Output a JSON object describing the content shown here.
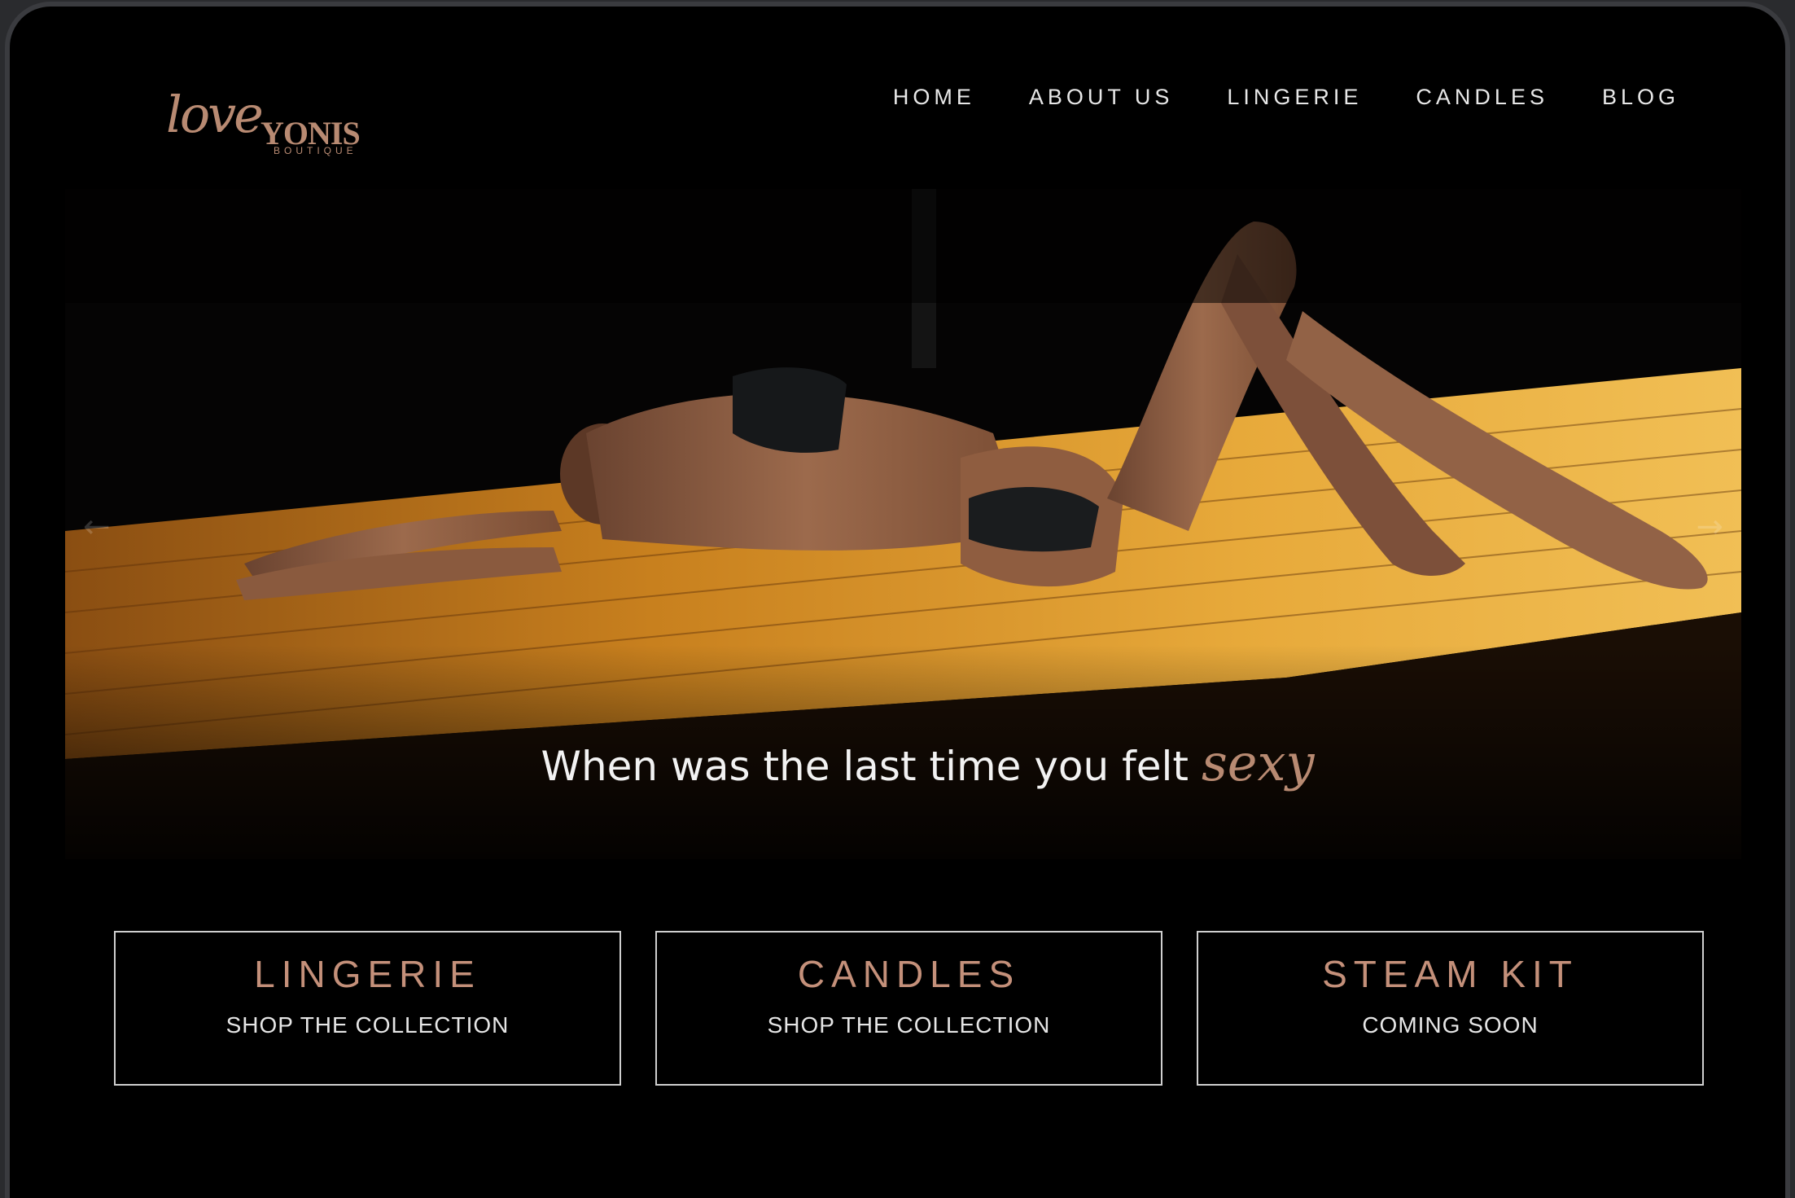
{
  "logo": {
    "script": "love",
    "caps": "YONIS",
    "sub": "BOUTIQUE"
  },
  "nav": {
    "items": [
      {
        "label": "HOME"
      },
      {
        "label": "ABOUT US"
      },
      {
        "label": "LINGERIE"
      },
      {
        "label": "CANDLES"
      },
      {
        "label": "BLOG"
      }
    ]
  },
  "hero": {
    "caption_plain": "When was the last time you felt",
    "caption_script": "sexy",
    "prev_icon": "arrow-left-icon",
    "next_icon": "arrow-right-icon"
  },
  "cards": [
    {
      "title": "LINGERIE",
      "subtitle": "SHOP THE COLLECTION"
    },
    {
      "title": "CANDLES",
      "subtitle": "SHOP THE COLLECTION"
    },
    {
      "title": "STEAM KIT",
      "subtitle": "COMING SOON"
    }
  ],
  "colors": {
    "background": "#000000",
    "accent": "#b88a72",
    "text": "#e8e8e8",
    "card_border": "#cfcfcf"
  }
}
